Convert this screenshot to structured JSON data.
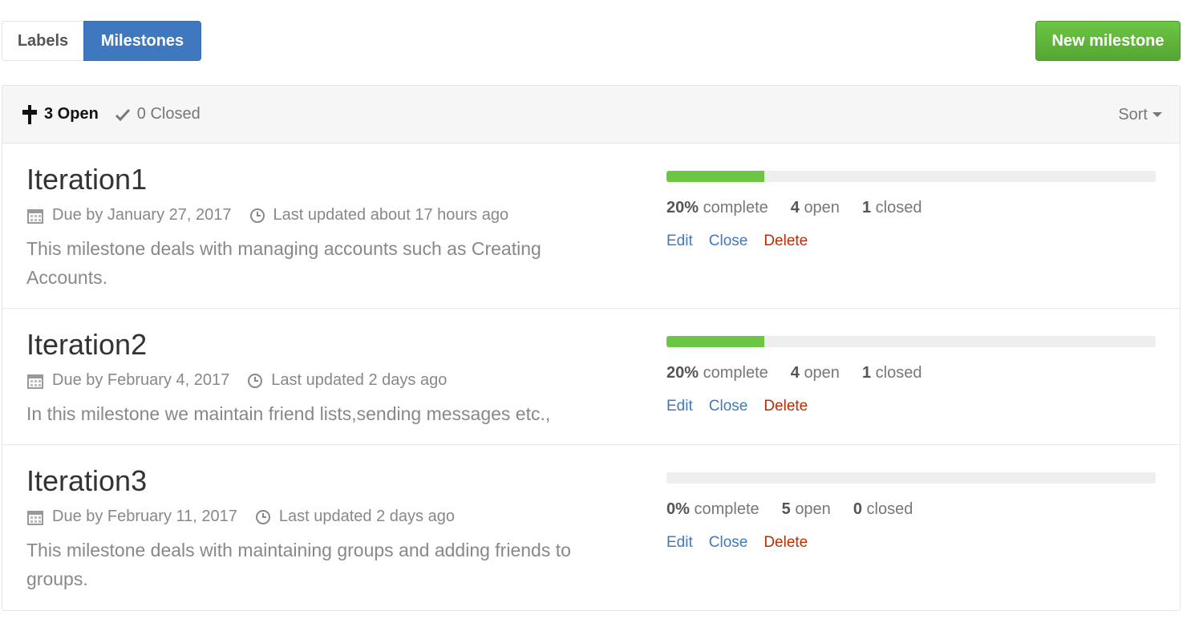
{
  "nav": {
    "labels": "Labels",
    "milestones": "Milestones",
    "new_milestone": "New milestone"
  },
  "header": {
    "open_label": "3 Open",
    "closed_label": "0 Closed",
    "sort_label": "Sort"
  },
  "colors": {
    "accent": "#4078c0",
    "success": "#6cc644",
    "danger": "#bd2c00"
  },
  "milestones": [
    {
      "title": "Iteration1",
      "due": "Due by January 27, 2017",
      "updated": "Last updated about 17 hours ago",
      "description": "This milestone deals with managing accounts such as Creating Accounts.",
      "progress": 20,
      "percent": "20%",
      "complete_label": "complete",
      "open_count": "4",
      "open_label": "open",
      "closed_count": "1",
      "closed_label": "closed",
      "edit": "Edit",
      "close": "Close",
      "delete": "Delete"
    },
    {
      "title": "Iteration2",
      "due": "Due by February 4, 2017",
      "updated": "Last updated 2 days ago",
      "description": "In this milestone we maintain friend lists,sending messages etc.,",
      "progress": 20,
      "percent": "20%",
      "complete_label": "complete",
      "open_count": "4",
      "open_label": "open",
      "closed_count": "1",
      "closed_label": "closed",
      "edit": "Edit",
      "close": "Close",
      "delete": "Delete"
    },
    {
      "title": "Iteration3",
      "due": "Due by February 11, 2017",
      "updated": "Last updated 2 days ago",
      "description": "This milestone deals with maintaining groups and adding friends to groups.",
      "progress": 0,
      "percent": "0%",
      "complete_label": "complete",
      "open_count": "5",
      "open_label": "open",
      "closed_count": "0",
      "closed_label": "closed",
      "edit": "Edit",
      "close": "Close",
      "delete": "Delete"
    }
  ]
}
